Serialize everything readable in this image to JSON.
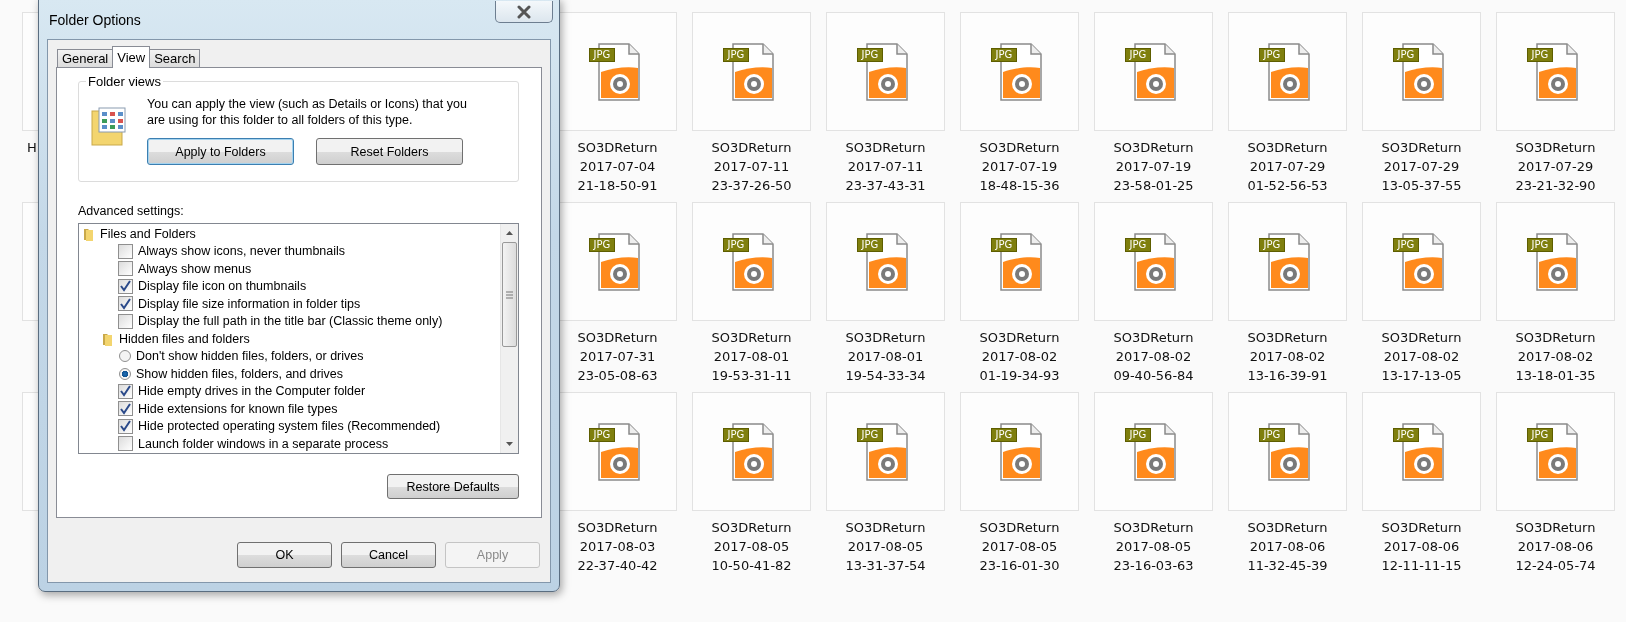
{
  "explorer": {
    "partial_label": "H",
    "files": [
      {
        "type": "JPG",
        "name": "SO3DReturn 2017-07-04 21-18-50-91"
      },
      {
        "type": "JPG",
        "name": "SO3DReturn 2017-07-11 23-37-26-50"
      },
      {
        "type": "JPG",
        "name": "SO3DReturn 2017-07-11 23-37-43-31"
      },
      {
        "type": "JPG",
        "name": "SO3DReturn 2017-07-19 18-48-15-36"
      },
      {
        "type": "JPG",
        "name": "SO3DReturn 2017-07-19 23-58-01-25"
      },
      {
        "type": "JPG",
        "name": "SO3DReturn 2017-07-29 01-52-56-53"
      },
      {
        "type": "JPG",
        "name": "SO3DReturn 2017-07-29 13-05-37-55"
      },
      {
        "type": "JPG",
        "name": "SO3DReturn 2017-07-29 23-21-32-90"
      },
      {
        "type": "JPG",
        "name": "SO3DReturn 2017-07-31 23-05-08-63"
      },
      {
        "type": "JPG",
        "name": "SO3DReturn 2017-08-01 19-53-31-11"
      },
      {
        "type": "JPG",
        "name": "SO3DReturn 2017-08-01 19-54-33-34"
      },
      {
        "type": "JPG",
        "name": "SO3DReturn 2017-08-02 01-19-34-93"
      },
      {
        "type": "JPG",
        "name": "SO3DReturn 2017-08-02 09-40-56-84"
      },
      {
        "type": "JPG",
        "name": "SO3DReturn 2017-08-02 13-16-39-91"
      },
      {
        "type": "JPG",
        "name": "SO3DReturn 2017-08-02 13-17-13-05"
      },
      {
        "type": "JPG",
        "name": "SO3DReturn 2017-08-02 13-18-01-35"
      },
      {
        "type": "JPG",
        "name": "SO3DReturn 2017-08-03 22-37-40-42"
      },
      {
        "type": "JPG",
        "name": "SO3DReturn 2017-08-05 10-50-41-82"
      },
      {
        "type": "JPG",
        "name": "SO3DReturn 2017-08-05 13-31-37-54"
      },
      {
        "type": "JPG",
        "name": "SO3DReturn 2017-08-05 23-16-01-30"
      },
      {
        "type": "JPG",
        "name": "SO3DReturn 2017-08-05 23-16-03-63"
      },
      {
        "type": "JPG",
        "name": "SO3DReturn 2017-08-06 11-32-45-39"
      },
      {
        "type": "JPG",
        "name": "SO3DReturn 2017-08-06 12-11-11-15"
      },
      {
        "type": "JPG",
        "name": "SO3DReturn 2017-08-06 12-24-05-74"
      }
    ]
  },
  "dialog": {
    "title": "Folder Options",
    "tabs": [
      {
        "label": "General",
        "selected": false
      },
      {
        "label": "View",
        "selected": true
      },
      {
        "label": "Search",
        "selected": false
      }
    ],
    "folder_views": {
      "legend": "Folder views",
      "description": "You can apply the view (such as Details or Icons) that you are using for this folder to all folders of this type.",
      "buttons": [
        {
          "label": "Apply to Folders",
          "focused": true
        },
        {
          "label": "Reset Folders",
          "focused": false
        }
      ]
    },
    "advanced_label": "Advanced settings:",
    "settings": [
      {
        "kind": "group",
        "label": "Files and Folders",
        "children": [
          {
            "kind": "checkbox",
            "label": "Always show icons, never thumbnails",
            "checked": false
          },
          {
            "kind": "checkbox",
            "label": "Always show menus",
            "checked": false
          },
          {
            "kind": "checkbox",
            "label": "Display file icon on thumbnails",
            "checked": true
          },
          {
            "kind": "checkbox",
            "label": "Display file size information in folder tips",
            "checked": true
          },
          {
            "kind": "checkbox",
            "label": "Display the full path in the title bar (Classic theme only)",
            "checked": false
          },
          {
            "kind": "group",
            "label": "Hidden files and folders",
            "children": [
              {
                "kind": "radio",
                "label": "Don't show hidden files, folders, or drives",
                "selected": false
              },
              {
                "kind": "radio",
                "label": "Show hidden files, folders, and drives",
                "selected": true
              }
            ]
          },
          {
            "kind": "checkbox",
            "label": "Hide empty drives in the Computer folder",
            "checked": true
          },
          {
            "kind": "checkbox",
            "label": "Hide extensions for known file types",
            "checked": true
          },
          {
            "kind": "checkbox",
            "label": "Hide protected operating system files (Recommended)",
            "checked": true
          },
          {
            "kind": "checkbox",
            "label": "Launch folder windows in a separate process",
            "checked": false
          }
        ]
      }
    ],
    "restore_button": "Restore Defaults",
    "buttons": [
      {
        "label": "OK",
        "disabled": false
      },
      {
        "label": "Cancel",
        "disabled": false
      },
      {
        "label": "Apply",
        "disabled": true
      }
    ]
  }
}
